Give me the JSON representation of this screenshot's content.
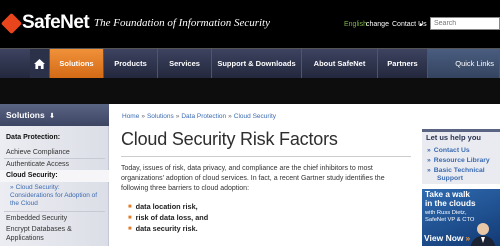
{
  "header": {
    "logo_text": "SafeNet",
    "tagline": "The Foundation of Information Security",
    "language": "English",
    "change": "change",
    "contact": "Contact Us",
    "contact_arrow": "▸",
    "search_placeholder": "Search"
  },
  "nav": {
    "items": [
      "Solutions",
      "Products",
      "Services",
      "Support & Downloads",
      "About SafeNet",
      "Partners",
      "Quick Links"
    ]
  },
  "sidebar": {
    "heading": "Solutions",
    "heading_arrow": "⬇",
    "section1": "Data Protection:",
    "link1": "Achieve Compliance",
    "link2": "Authenticate Access",
    "section2": "Cloud Security:",
    "sub_bullet": "»",
    "sub_item": "Cloud Security: Considerations for Adoption of the Cloud",
    "link3": "Embedded Security",
    "link4": "Encrypt Databases &",
    "link5": "Applications"
  },
  "breadcrumb": [
    "Home",
    "Solutions",
    "Data Protection",
    "Cloud Security"
  ],
  "breadcrumb_sep": "»",
  "main": {
    "title": "Cloud Security Risk Factors",
    "intro": "Today, issues of risk, data privacy, and compliance are the chief inhibitors to most organizations' adoption of cloud services. In fact, a recent Gartner study identifies the following three barriers to cloud adoption:",
    "barriers": [
      "data location risk,",
      "risk of data loss, and",
      "data security risk."
    ],
    "barrier_bullet": "■"
  },
  "help": {
    "title": "Let us help you",
    "bullet": "»",
    "links": [
      "Contact Us",
      "Resource Library",
      "Basic Technical",
      "Support"
    ]
  },
  "promo": {
    "line1": "Take a walk",
    "line2": "in the clouds",
    "line3": "with Russ Dietz,",
    "line4": "SafeNet VP & CTO",
    "cta": "View Now",
    "cta_arrow": "»"
  },
  "colors": {
    "brand_orange": "#e8451c",
    "nav_active": "#e07d28",
    "link_blue": "#3b6ab0",
    "nav_dark": "#2f354f"
  }
}
